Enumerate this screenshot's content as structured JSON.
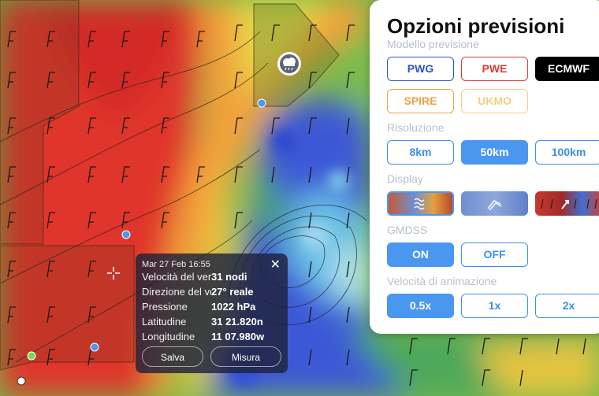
{
  "map": {
    "icons": [
      "rain-cloud-icon",
      "crosshair-icon",
      "wind-barb-icon",
      "location-marker-icon"
    ]
  },
  "tooltip": {
    "datetime": "Mar 27 Feb 16:55",
    "rows": [
      {
        "label": "Velocità del vento",
        "value": "31 nodi"
      },
      {
        "label": "Direzione del vento",
        "value": "27° reale"
      },
      {
        "label": "Pressione",
        "value": "1022 hPa"
      },
      {
        "label": "Latitudine",
        "value": "31 21.820n"
      },
      {
        "label": "Longitudine",
        "value": "11 07.980w"
      }
    ],
    "save_label": "Salva",
    "measure_label": "Misura",
    "close_glyph": "✕"
  },
  "panel": {
    "title": "Opzioni previsioni",
    "model": {
      "label": "Modello previsione",
      "options": [
        "PWG",
        "PWE",
        "ECMWF",
        "SPIRE",
        "UKMO"
      ],
      "selected": "ECMWF"
    },
    "resolution": {
      "label": "Risoluzione",
      "options": [
        "8km",
        "50km",
        "100km"
      ],
      "selected": "50km"
    },
    "display": {
      "label": "Display",
      "selected": 0
    },
    "gmdss": {
      "label": "GMDSS",
      "options": [
        "ON",
        "OFF"
      ],
      "selected": "ON"
    },
    "speed": {
      "label": "Velocità di animazione",
      "options": [
        "0.5x",
        "1x",
        "2x"
      ],
      "selected": "0.5x"
    }
  },
  "colors": {
    "accent": "#4a97ef",
    "wind_high": "#d93a2b",
    "wind_mid": "#f0a035",
    "wind_low": "#3a55d8"
  }
}
